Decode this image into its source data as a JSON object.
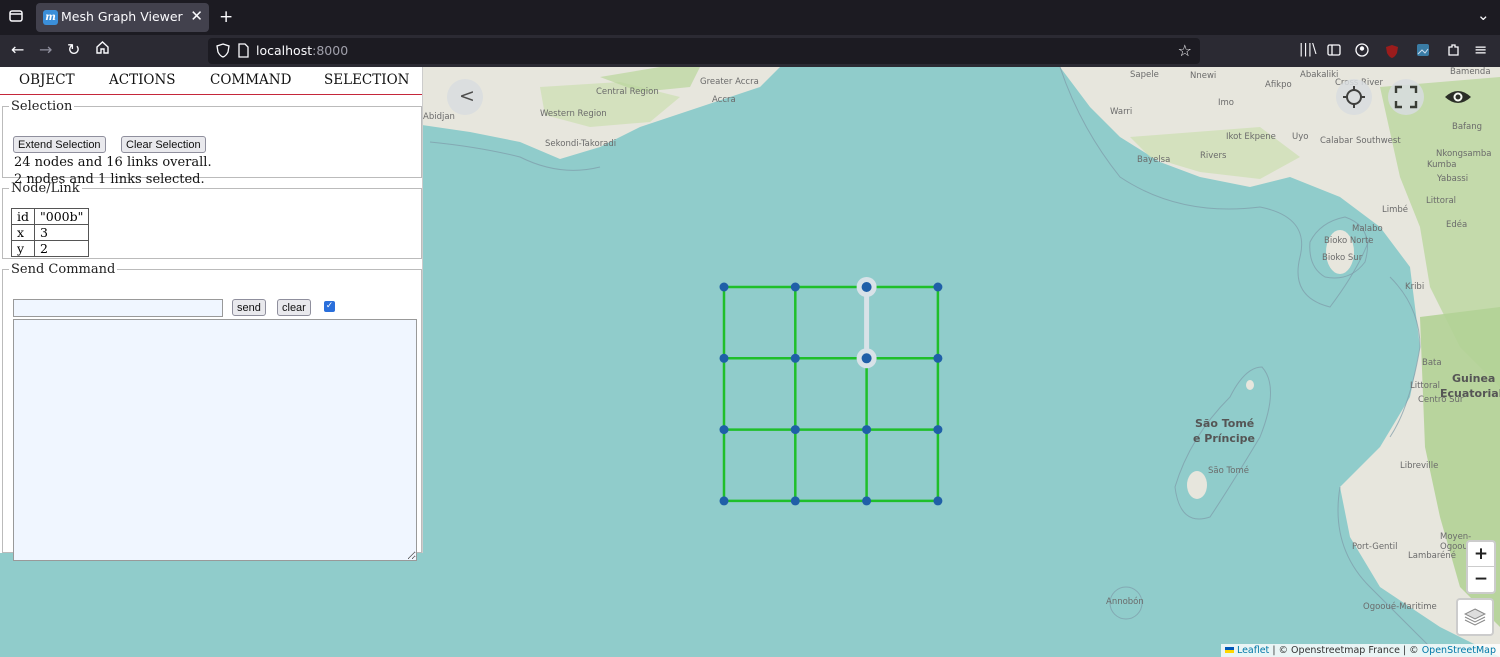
{
  "browser": {
    "tab_title": "Mesh Graph Viewer",
    "tab_favicon_letter": "m",
    "url_host": "localhost",
    "url_port": ":8000"
  },
  "panel": {
    "tabs": [
      "OBJECT",
      "ACTIONS",
      "COMMAND",
      "SELECTION"
    ],
    "selection": {
      "legend": "Selection",
      "extend_label": "Extend Selection",
      "clear_label": "Clear Selection",
      "overall_text": "24 nodes and 16 links overall.",
      "selected_text": "2 nodes and 1 links selected."
    },
    "nodelink": {
      "legend": "Node/Link",
      "rows": [
        {
          "key": "id",
          "value": "\"000b\""
        },
        {
          "key": "x",
          "value": "3"
        },
        {
          "key": "y",
          "value": "2"
        }
      ]
    },
    "command": {
      "legend": "Send Command",
      "input_value": "",
      "send_label": "send",
      "clear_label": "clear",
      "checkbox_checked": true,
      "output_text": ""
    }
  },
  "map": {
    "collapse_label": "<",
    "zoom_in_label": "+",
    "zoom_out_label": "−",
    "attribution_leaflet": "Leaflet",
    "attribution_text": " | © Openstreetmap France | © ",
    "attribution_osm": "OpenStreetMap",
    "labels": [
      "Greater Accra",
      "Central Region",
      "Accra",
      "Western Region",
      "Abidjan",
      "Sekondi-Takoradi",
      "Sapele",
      "Nnewi",
      "Abakaliki",
      "Cross River",
      "Bamenda",
      "Bafang",
      "Warri",
      "Imo",
      "Afikpo",
      "Ikot Ekpene",
      "Uyo",
      "Calabar",
      "Bayelsa",
      "Rivers",
      "Southwest",
      "Nkongsamba",
      "Kumba",
      "Yabassi",
      "Littoral",
      "Limbé",
      "Edéa",
      "Malabo",
      "Bioko Norte",
      "Bioko Sur",
      "Kribi",
      "Bata",
      "Littoral",
      "Centro Sur",
      "Guinea",
      "Ecuatorial",
      "São Tomé",
      "e Príncipe",
      "São Tomé",
      "Libreville",
      "Port-Gentil",
      "Lambaréné",
      "Moyen-Ogooué",
      "Ogooué-Maritime",
      "Annobón"
    ],
    "graph": {
      "node_count": 24,
      "link_count": 16,
      "grid_columns": 4,
      "grid_rows": 4,
      "link_color": "#1fbf2a",
      "node_color": "#1f5fa8",
      "selected_link_color": "#d8e2e8"
    }
  }
}
